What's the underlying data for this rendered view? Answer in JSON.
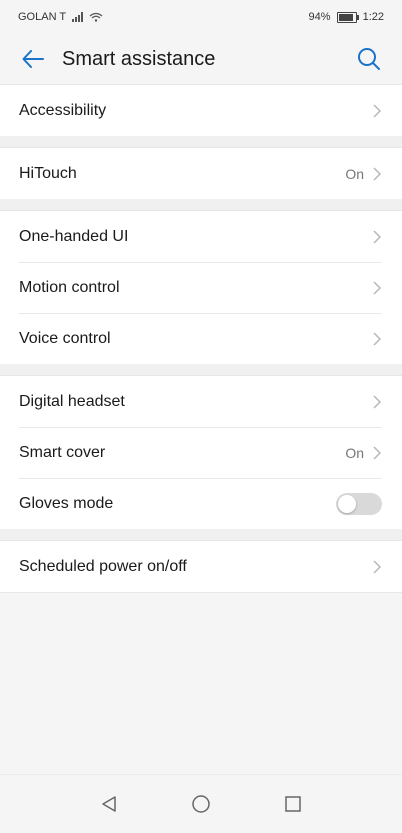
{
  "status_bar": {
    "carrier": "GOLAN T",
    "battery": "94%",
    "time": "1:22"
  },
  "header": {
    "title": "Smart assistance"
  },
  "sections": [
    {
      "items": [
        {
          "label": "Accessibility"
        }
      ]
    },
    {
      "items": [
        {
          "label": "HiTouch",
          "value": "On"
        }
      ]
    },
    {
      "items": [
        {
          "label": "One-handed UI"
        },
        {
          "label": "Motion control"
        },
        {
          "label": "Voice control"
        }
      ]
    },
    {
      "items": [
        {
          "label": "Digital headset"
        },
        {
          "label": "Smart cover",
          "value": "On"
        },
        {
          "label": "Gloves mode",
          "toggle": false
        }
      ]
    },
    {
      "items": [
        {
          "label": "Scheduled power on/off"
        }
      ]
    }
  ],
  "icons": {
    "back": "arrow-left-icon",
    "search": "search-icon",
    "chevron": "chevron-right-icon"
  },
  "colors": {
    "accent": "#1a73c9",
    "toggle_off": "#d9d9d9"
  }
}
